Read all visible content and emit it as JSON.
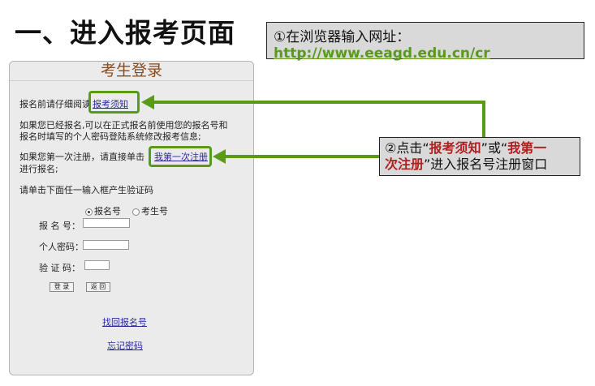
{
  "slide": {
    "title": "一、进入报考页面"
  },
  "callout1": {
    "line1": "①在浏览器输入网址：",
    "url": "http://www.eeagd.edu.cn/cr"
  },
  "login": {
    "header": "考生登录",
    "notice_prefix": "报名前请仔细阅读",
    "notice_link": "报考须知",
    "registered_line1": "如果您已经报名,可以在正式报名前使用您的报名号和",
    "registered_line2": "报名时填写的个人密码登陆系统修改报考信息;",
    "first_time_prefix": "如果您第一次注册，请直接单击",
    "first_time_link": "我第一次注册",
    "first_time_suffix": "进行报名;",
    "captcha_hint": "请单击下面任一输入框产生验证码",
    "radio_options": [
      "报名号",
      "考生号"
    ],
    "labels": {
      "reg_no": "报 名 号：",
      "password": "个人密码：",
      "captcha": "验 证 码："
    },
    "buttons": {
      "login": "登 录",
      "back": "返 回"
    },
    "links": {
      "find_reg_no": "找回报名号",
      "forgot_password": "忘记密码"
    }
  },
  "callout2": {
    "prefix": "②点击“",
    "link1": "报考须知",
    "mid": "”或“",
    "link2a": "我第一",
    "link2b": "次注册",
    "suffix": "”进入报名号注册窗口"
  },
  "colors": {
    "green": "#5a9a1a",
    "red": "#b02020",
    "header": "#8a4a1a"
  }
}
